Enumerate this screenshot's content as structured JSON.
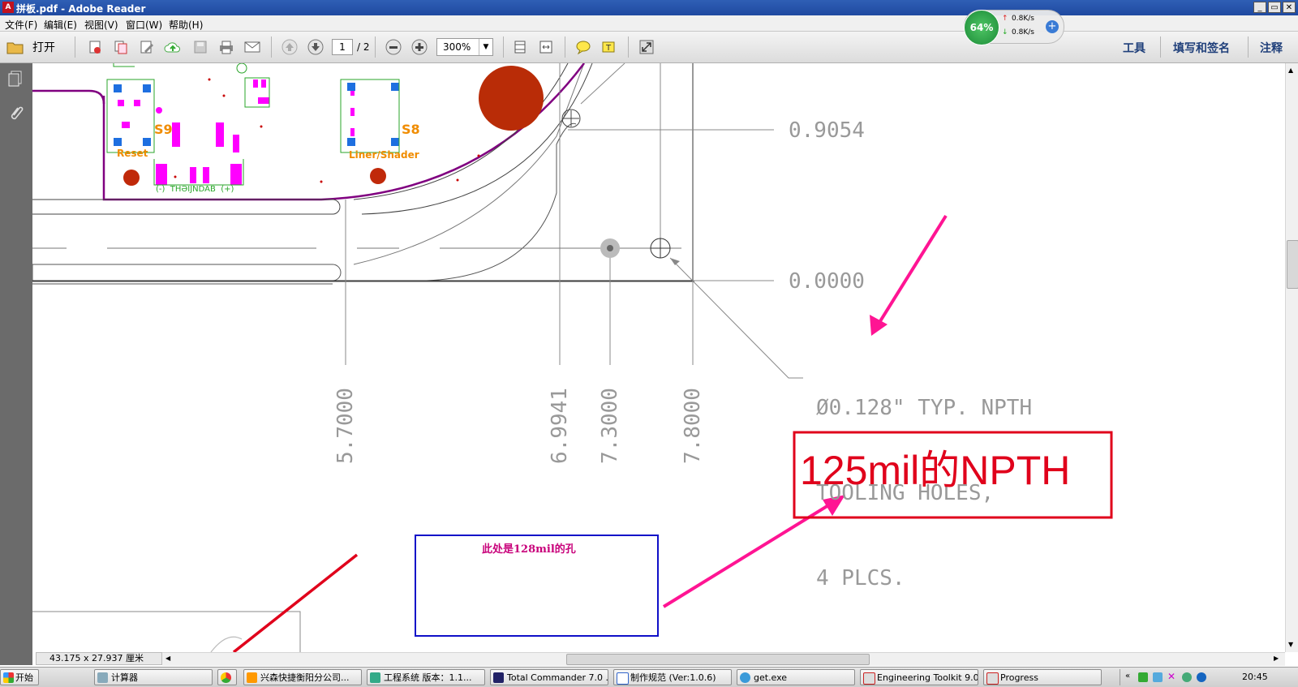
{
  "window": {
    "title": "拼板.pdf - Adobe Reader"
  },
  "menu": [
    {
      "label": "文件(F)"
    },
    {
      "label": "编辑(E)"
    },
    {
      "label": "视图(V)"
    },
    {
      "label": "窗口(W)"
    },
    {
      "label": "帮助(H)"
    }
  ],
  "toolbar": {
    "open_label": "打开",
    "page_current": "1",
    "page_total": "/ 2",
    "zoom": "300%",
    "right_tools": [
      "工具",
      "填写和签名",
      "注释"
    ]
  },
  "net_widget": {
    "percent": "64%",
    "up": "0.8K/s",
    "down": "0.8K/s"
  },
  "drawing": {
    "dim_right": [
      "0.9054",
      "0.0000"
    ],
    "dim_bottom": [
      "5.7000",
      "6.9941",
      "7.3000",
      "7.8000"
    ],
    "callout": [
      "Ø0.128\" TYP. NPTH",
      "TOOLING HOLES,",
      "4 PLCS."
    ],
    "pcb_labels": [
      "S9",
      "S8",
      "Reset",
      "Liner/Shader",
      "(-)  THƏIJNDAB  (+)"
    ],
    "annot_red": "125mil的NPTH",
    "annot_blue": "此处是128mil的孔"
  },
  "status": {
    "page_size": "43.175 x 27.937 厘米"
  },
  "taskbar": {
    "start": "开始",
    "tasks": [
      {
        "label": "计算器"
      },
      {
        "label": "兴森快捷衡阳分公司..."
      },
      {
        "label": "工程系统  版本：1.1..."
      },
      {
        "label": "Total Commander 7.0 ..."
      },
      {
        "label": "制作规范 (Ver:1.0.6)"
      },
      {
        "label": "get.exe"
      },
      {
        "label": "Engineering Toolkit 9.0..."
      },
      {
        "label": "Progress"
      }
    ],
    "clock": "20:45"
  },
  "colors": {
    "magenta": "#ff1493",
    "pcb_outline": "#800080",
    "red_box": "#e0001b",
    "blue_box": "#1010c8"
  }
}
